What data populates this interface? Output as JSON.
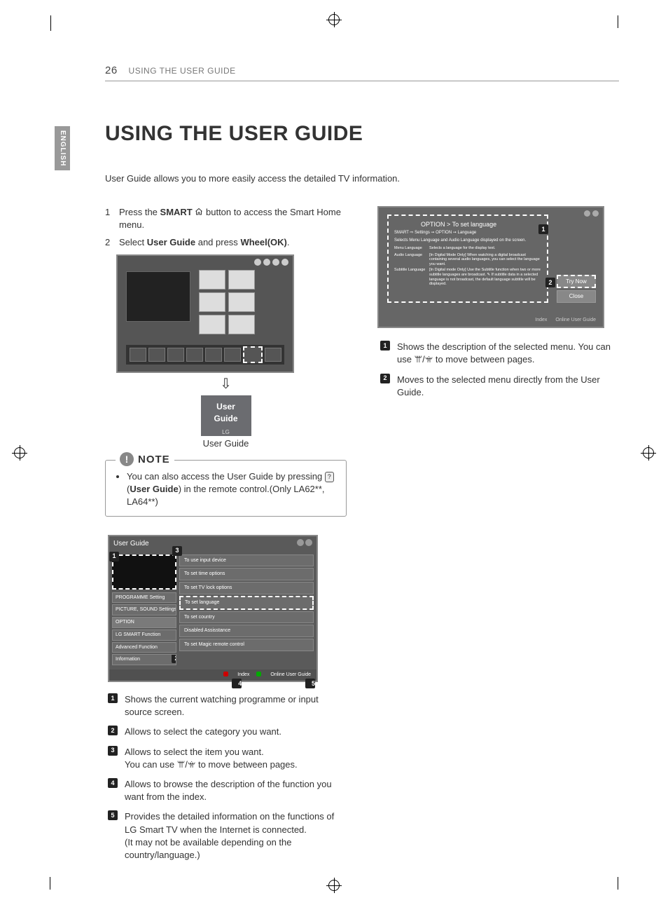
{
  "header": {
    "page_number": "26",
    "running_head": "USING THE USER GUIDE",
    "language_tab": "ENGLISH"
  },
  "title": "USING THE USER GUIDE",
  "intro": "User Guide allows you to more easily access the detailed TV information.",
  "steps": {
    "s1_a": "Press the ",
    "s1_smart": "SMART",
    "s1_b": " button to access the Smart Home menu.",
    "s2_a": "Select ",
    "s2_ug": "User Guide",
    "s2_b": " and press ",
    "s2_wheel": "Wheel(OK)",
    "s2_c": "."
  },
  "tile": {
    "line1": "User",
    "line2": "Guide",
    "brand": "LG"
  },
  "tile_caption": "User Guide",
  "note": {
    "label": "NOTE",
    "text_a": "You can also access the User Guide by pressing ",
    "btn": "?",
    "text_b": "(",
    "btn_label": "User Guide",
    "text_c": ") in the remote control.(Only LA62**, LA64**)"
  },
  "ugshot": {
    "title": "User Guide",
    "categories": [
      "PROGRAMME Setting",
      "PICTURE, SOUND Settings",
      "OPTION",
      "LG SMART Function",
      "Advanced Function",
      "Information"
    ],
    "items": [
      "To use input device",
      "To set time options",
      "To set TV lock options",
      "To set language",
      "To set country",
      "Disabled Assisstance",
      "To set Magic remote control"
    ],
    "footer_index": "Index",
    "footer_online": "Online User Guide"
  },
  "left_callouts": [
    "Shows the current watching programme or input source screen.",
    "Allows to select the category you want.",
    "Allows to select the item you want.\nYou can use ꕌ/ꕍ to move between pages.",
    "Allows to browse the description of the function you want from the index.",
    "Provides the detailed information on the functions of LG Smart TV when the Internet is connected.\n(It may not be available depending on the country/language.)"
  ],
  "rshot": {
    "header": "OPTION > To set language",
    "crumb": "SMART ⇨ Settings ➙ OPTION ➙ Language",
    "desc": "Selects Menu Language and Audio Language displayed on the screen.",
    "rows": [
      {
        "k": "Menu Language",
        "v": "Selects a language for the display text."
      },
      {
        "k": "Audio Language",
        "v": "[In Digital Mode Only] When watching a digital broadcast containing several audio languages, you can select the language you want."
      },
      {
        "k": "Subtitle Language",
        "v": "[In Digital mode Only] Use the Subtitle function when two or more subtitle languages are broadcast. ✎ If subtitle data in a selected language is not broadcast, the default language subtitle will be displayed."
      }
    ],
    "try_now": "Try Now",
    "close": "Close",
    "footer_index": "Index",
    "footer_online": "Online User Guide"
  },
  "right_callouts": [
    "Shows the description of the selected menu. You can use ꕌ/ꕍ to move between pages.",
    "Moves to the selected menu directly from the User Guide."
  ],
  "labels": {
    "updown": "ꕌ/ꕍ"
  }
}
